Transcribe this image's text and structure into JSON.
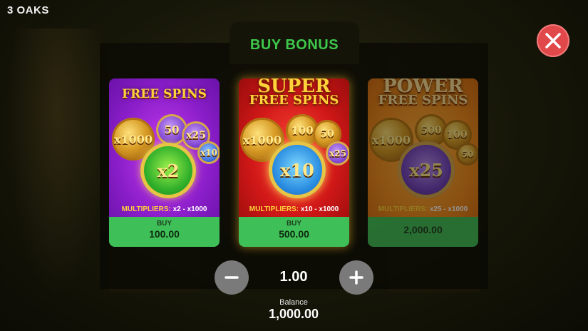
{
  "game": {
    "title": "3 OAKS"
  },
  "dialog": {
    "title": "BUY BONUS"
  },
  "cards": [
    {
      "title_line1": "FREE SPINS",
      "coins": [
        "x1000",
        "50",
        "x25",
        "x10",
        "x2"
      ],
      "multipliers_label": "MULTIPLIERS:",
      "multipliers_range": "x2 - x1000",
      "buy_label": "BUY",
      "price": "100.00",
      "enabled": true
    },
    {
      "title_line1": "SUPER",
      "title_line2": "FREE SPINS",
      "coins": [
        "x1000",
        "100",
        "50",
        "x25",
        "x10"
      ],
      "multipliers_label": "MULTIPLIERS:",
      "multipliers_range": "x10 - x1000",
      "buy_label": "BUY",
      "price": "500.00",
      "enabled": true
    },
    {
      "title_line1": "POWER",
      "title_line2": "FREE SPINS",
      "coins": [
        "x1000",
        "500",
        "100",
        "50",
        "x25"
      ],
      "multipliers_label": "MULTIPLIERS:",
      "multipliers_range": "x25 - x1000",
      "price": "2,000.00",
      "enabled": false
    }
  ],
  "stake": {
    "value": "1.00"
  },
  "balance": {
    "label": "Balance",
    "value": "1,000.00"
  },
  "icons": {
    "close": "close-icon",
    "minus": "minus-icon",
    "plus": "plus-icon"
  },
  "colors": {
    "accent_green": "#3ec84a",
    "close_red": "#e0484a",
    "buy_green": "#3fbf57"
  }
}
